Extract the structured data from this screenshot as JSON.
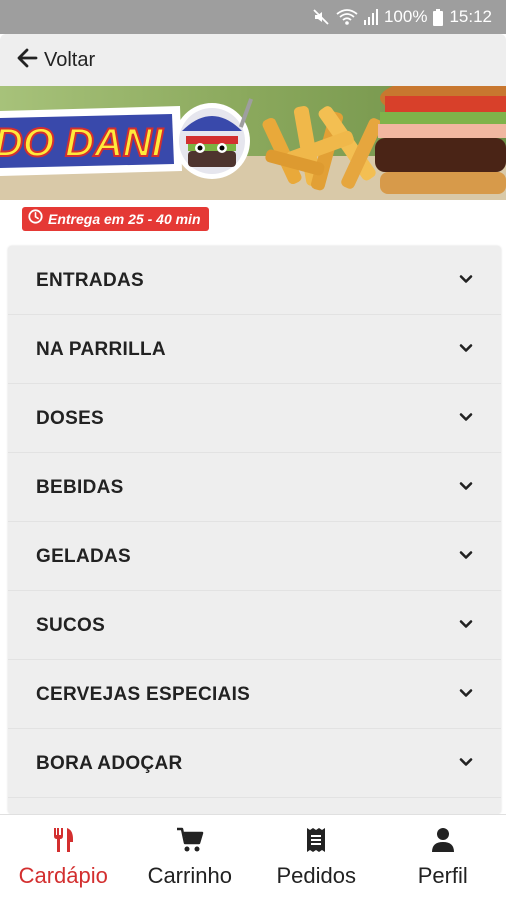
{
  "status_bar": {
    "battery": "100%",
    "time": "15:12"
  },
  "header": {
    "back_label": "Voltar"
  },
  "banner": {
    "logo_text": "DO DANI"
  },
  "delivery": {
    "text": "Entrega em 25 - 40 min"
  },
  "menu": {
    "items": [
      {
        "label": "ENTRADAS"
      },
      {
        "label": "NA PARRILLA"
      },
      {
        "label": "DOSES"
      },
      {
        "label": "BEBIDAS"
      },
      {
        "label": "GELADAS"
      },
      {
        "label": "SUCOS"
      },
      {
        "label": "CERVEJAS ESPECIAIS"
      },
      {
        "label": "BORA ADOÇAR"
      },
      {
        "label": ""
      }
    ]
  },
  "bottom_nav": {
    "items": [
      {
        "label": "Cardápio",
        "icon": "fork-knife-icon"
      },
      {
        "label": "Carrinho",
        "icon": "cart-icon"
      },
      {
        "label": "Pedidos",
        "icon": "receipt-icon"
      },
      {
        "label": "Perfil",
        "icon": "user-icon"
      }
    ]
  },
  "colors": {
    "accent": "#d32f2f",
    "badge": "#e53935",
    "status_bar": "#9e9e9e"
  }
}
